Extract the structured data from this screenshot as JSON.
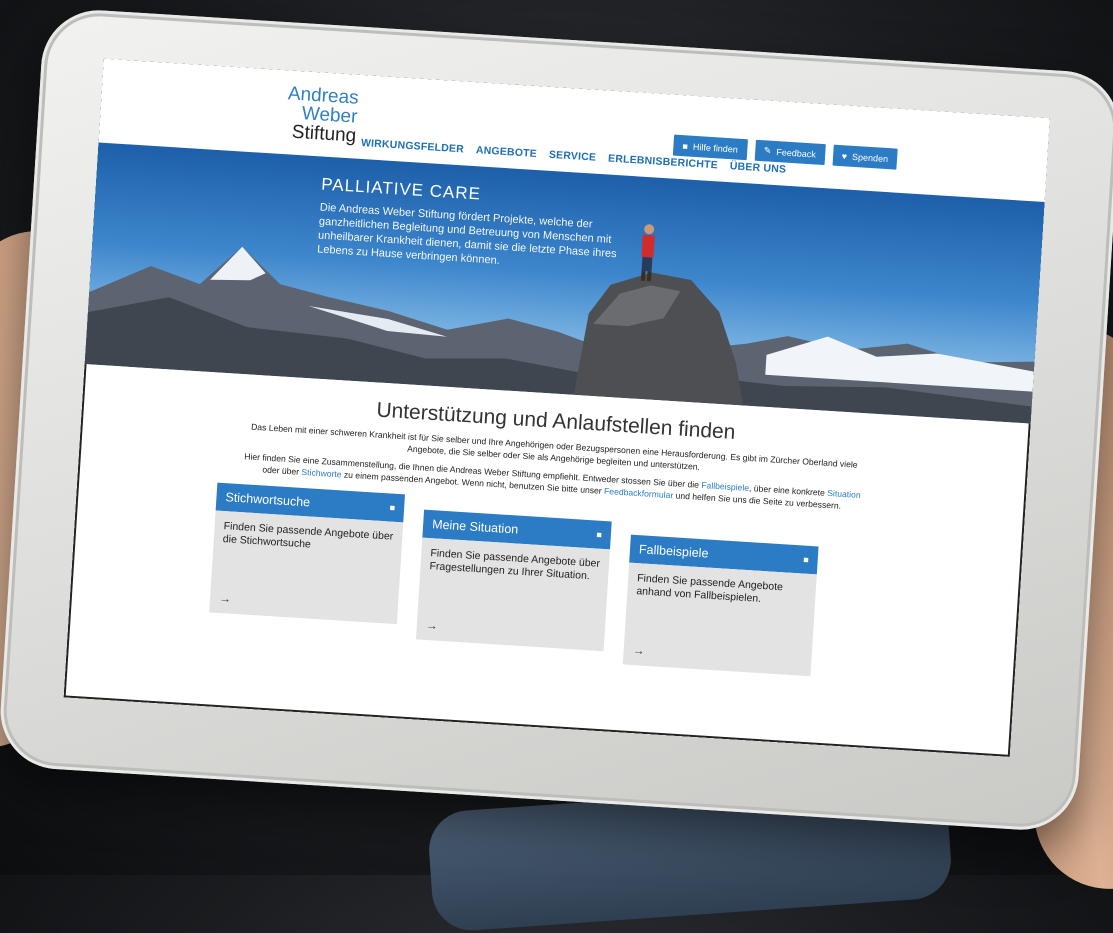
{
  "logo": {
    "line1": "Andreas",
    "line2": "Weber",
    "line3": "Stiftung"
  },
  "toolbar": {
    "help_label": "Hilfe finden",
    "feedback_label": "Feedback",
    "donate_label": "Spenden"
  },
  "nav": {
    "items": [
      {
        "label": "WIRKUNGSFELDER"
      },
      {
        "label": "ANGEBOTE"
      },
      {
        "label": "SERVICE"
      },
      {
        "label": "ERLEBNISBERICHTE"
      },
      {
        "label": "ÜBER UNS"
      }
    ]
  },
  "hero": {
    "title": "PALLIATIVE CARE",
    "body": "Die Andreas Weber Stiftung fördert Projekte, welche der ganzheitlichen Begleitung und Betreuung von Menschen mit unheilbarer Krankheit dienen, damit sie die letzte Phase ihres Lebens zu Hause verbringen können."
  },
  "main": {
    "title": "Unterstützung und Anlaufstellen finden",
    "intro1": "Das Leben mit einer schweren Krankheit ist für Sie selber und Ihre Angehörigen oder Bezugspersonen eine Herausforderung. Es gibt im Zürcher Oberland viele Angebote, die Sie selber oder Sie als Angehörige begleiten und unterstützen.",
    "intro2_a": "Hier finden Sie eine Zusammenstellung, die Ihnen die Andreas Weber Stiftung empfiehlt. Entweder stossen Sie über die",
    "link_fallbeispiele": "Fallbeispiele",
    "intro2_b": ", über eine konkrete",
    "link_situation": "Situation",
    "intro2_c": "oder über",
    "link_stichworte": "Stichworte",
    "intro2_d": "zu einem passenden Angebot. Wenn nicht, benutzen Sie bitte unser",
    "link_feedback": "Feedbackformular",
    "intro2_e": "und helfen Sie uns die Seite zu verbessern."
  },
  "cards": [
    {
      "title": "Stichwortsuche",
      "body": "Finden Sie passende Angebote über die Stichwortsuche",
      "arrow": "→"
    },
    {
      "title": "Meine Situation",
      "body": "Finden Sie passende Angebote über Fragestellungen zu Ihrer Situation.",
      "arrow": "→"
    },
    {
      "title": "Fallbeispiele",
      "body": "Finden Sie passende Angebote anhand von Fallbeispielen.",
      "arrow": "→"
    }
  ],
  "colors": {
    "brand_blue": "#2b7cc4",
    "card_bg": "#e3e3e3"
  },
  "icons": {
    "toolbar_help": "camera-icon",
    "toolbar_feedback": "edit-icon",
    "toolbar_donate": "heart-icon",
    "card": "camera-icon"
  }
}
